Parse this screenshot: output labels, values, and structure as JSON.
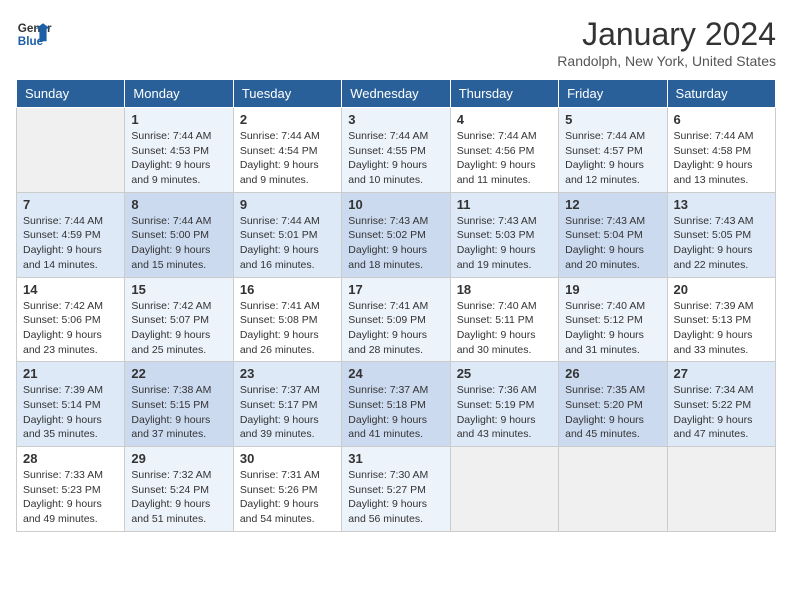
{
  "header": {
    "logo_line1": "General",
    "logo_line2": "Blue",
    "title": "January 2024",
    "subtitle": "Randolph, New York, United States"
  },
  "calendar": {
    "days_of_week": [
      "Sunday",
      "Monday",
      "Tuesday",
      "Wednesday",
      "Thursday",
      "Friday",
      "Saturday"
    ],
    "weeks": [
      [
        {
          "num": "",
          "sunrise": "",
          "sunset": "",
          "daylight": ""
        },
        {
          "num": "1",
          "sunrise": "Sunrise: 7:44 AM",
          "sunset": "Sunset: 4:53 PM",
          "daylight": "Daylight: 9 hours and 9 minutes."
        },
        {
          "num": "2",
          "sunrise": "Sunrise: 7:44 AM",
          "sunset": "Sunset: 4:54 PM",
          "daylight": "Daylight: 9 hours and 9 minutes."
        },
        {
          "num": "3",
          "sunrise": "Sunrise: 7:44 AM",
          "sunset": "Sunset: 4:55 PM",
          "daylight": "Daylight: 9 hours and 10 minutes."
        },
        {
          "num": "4",
          "sunrise": "Sunrise: 7:44 AM",
          "sunset": "Sunset: 4:56 PM",
          "daylight": "Daylight: 9 hours and 11 minutes."
        },
        {
          "num": "5",
          "sunrise": "Sunrise: 7:44 AM",
          "sunset": "Sunset: 4:57 PM",
          "daylight": "Daylight: 9 hours and 12 minutes."
        },
        {
          "num": "6",
          "sunrise": "Sunrise: 7:44 AM",
          "sunset": "Sunset: 4:58 PM",
          "daylight": "Daylight: 9 hours and 13 minutes."
        }
      ],
      [
        {
          "num": "7",
          "sunrise": "Sunrise: 7:44 AM",
          "sunset": "Sunset: 4:59 PM",
          "daylight": "Daylight: 9 hours and 14 minutes."
        },
        {
          "num": "8",
          "sunrise": "Sunrise: 7:44 AM",
          "sunset": "Sunset: 5:00 PM",
          "daylight": "Daylight: 9 hours and 15 minutes."
        },
        {
          "num": "9",
          "sunrise": "Sunrise: 7:44 AM",
          "sunset": "Sunset: 5:01 PM",
          "daylight": "Daylight: 9 hours and 16 minutes."
        },
        {
          "num": "10",
          "sunrise": "Sunrise: 7:43 AM",
          "sunset": "Sunset: 5:02 PM",
          "daylight": "Daylight: 9 hours and 18 minutes."
        },
        {
          "num": "11",
          "sunrise": "Sunrise: 7:43 AM",
          "sunset": "Sunset: 5:03 PM",
          "daylight": "Daylight: 9 hours and 19 minutes."
        },
        {
          "num": "12",
          "sunrise": "Sunrise: 7:43 AM",
          "sunset": "Sunset: 5:04 PM",
          "daylight": "Daylight: 9 hours and 20 minutes."
        },
        {
          "num": "13",
          "sunrise": "Sunrise: 7:43 AM",
          "sunset": "Sunset: 5:05 PM",
          "daylight": "Daylight: 9 hours and 22 minutes."
        }
      ],
      [
        {
          "num": "14",
          "sunrise": "Sunrise: 7:42 AM",
          "sunset": "Sunset: 5:06 PM",
          "daylight": "Daylight: 9 hours and 23 minutes."
        },
        {
          "num": "15",
          "sunrise": "Sunrise: 7:42 AM",
          "sunset": "Sunset: 5:07 PM",
          "daylight": "Daylight: 9 hours and 25 minutes."
        },
        {
          "num": "16",
          "sunrise": "Sunrise: 7:41 AM",
          "sunset": "Sunset: 5:08 PM",
          "daylight": "Daylight: 9 hours and 26 minutes."
        },
        {
          "num": "17",
          "sunrise": "Sunrise: 7:41 AM",
          "sunset": "Sunset: 5:09 PM",
          "daylight": "Daylight: 9 hours and 28 minutes."
        },
        {
          "num": "18",
          "sunrise": "Sunrise: 7:40 AM",
          "sunset": "Sunset: 5:11 PM",
          "daylight": "Daylight: 9 hours and 30 minutes."
        },
        {
          "num": "19",
          "sunrise": "Sunrise: 7:40 AM",
          "sunset": "Sunset: 5:12 PM",
          "daylight": "Daylight: 9 hours and 31 minutes."
        },
        {
          "num": "20",
          "sunrise": "Sunrise: 7:39 AM",
          "sunset": "Sunset: 5:13 PM",
          "daylight": "Daylight: 9 hours and 33 minutes."
        }
      ],
      [
        {
          "num": "21",
          "sunrise": "Sunrise: 7:39 AM",
          "sunset": "Sunset: 5:14 PM",
          "daylight": "Daylight: 9 hours and 35 minutes."
        },
        {
          "num": "22",
          "sunrise": "Sunrise: 7:38 AM",
          "sunset": "Sunset: 5:15 PM",
          "daylight": "Daylight: 9 hours and 37 minutes."
        },
        {
          "num": "23",
          "sunrise": "Sunrise: 7:37 AM",
          "sunset": "Sunset: 5:17 PM",
          "daylight": "Daylight: 9 hours and 39 minutes."
        },
        {
          "num": "24",
          "sunrise": "Sunrise: 7:37 AM",
          "sunset": "Sunset: 5:18 PM",
          "daylight": "Daylight: 9 hours and 41 minutes."
        },
        {
          "num": "25",
          "sunrise": "Sunrise: 7:36 AM",
          "sunset": "Sunset: 5:19 PM",
          "daylight": "Daylight: 9 hours and 43 minutes."
        },
        {
          "num": "26",
          "sunrise": "Sunrise: 7:35 AM",
          "sunset": "Sunset: 5:20 PM",
          "daylight": "Daylight: 9 hours and 45 minutes."
        },
        {
          "num": "27",
          "sunrise": "Sunrise: 7:34 AM",
          "sunset": "Sunset: 5:22 PM",
          "daylight": "Daylight: 9 hours and 47 minutes."
        }
      ],
      [
        {
          "num": "28",
          "sunrise": "Sunrise: 7:33 AM",
          "sunset": "Sunset: 5:23 PM",
          "daylight": "Daylight: 9 hours and 49 minutes."
        },
        {
          "num": "29",
          "sunrise": "Sunrise: 7:32 AM",
          "sunset": "Sunset: 5:24 PM",
          "daylight": "Daylight: 9 hours and 51 minutes."
        },
        {
          "num": "30",
          "sunrise": "Sunrise: 7:31 AM",
          "sunset": "Sunset: 5:26 PM",
          "daylight": "Daylight: 9 hours and 54 minutes."
        },
        {
          "num": "31",
          "sunrise": "Sunrise: 7:30 AM",
          "sunset": "Sunset: 5:27 PM",
          "daylight": "Daylight: 9 hours and 56 minutes."
        },
        {
          "num": "",
          "sunrise": "",
          "sunset": "",
          "daylight": ""
        },
        {
          "num": "",
          "sunrise": "",
          "sunset": "",
          "daylight": ""
        },
        {
          "num": "",
          "sunrise": "",
          "sunset": "",
          "daylight": ""
        }
      ]
    ]
  }
}
